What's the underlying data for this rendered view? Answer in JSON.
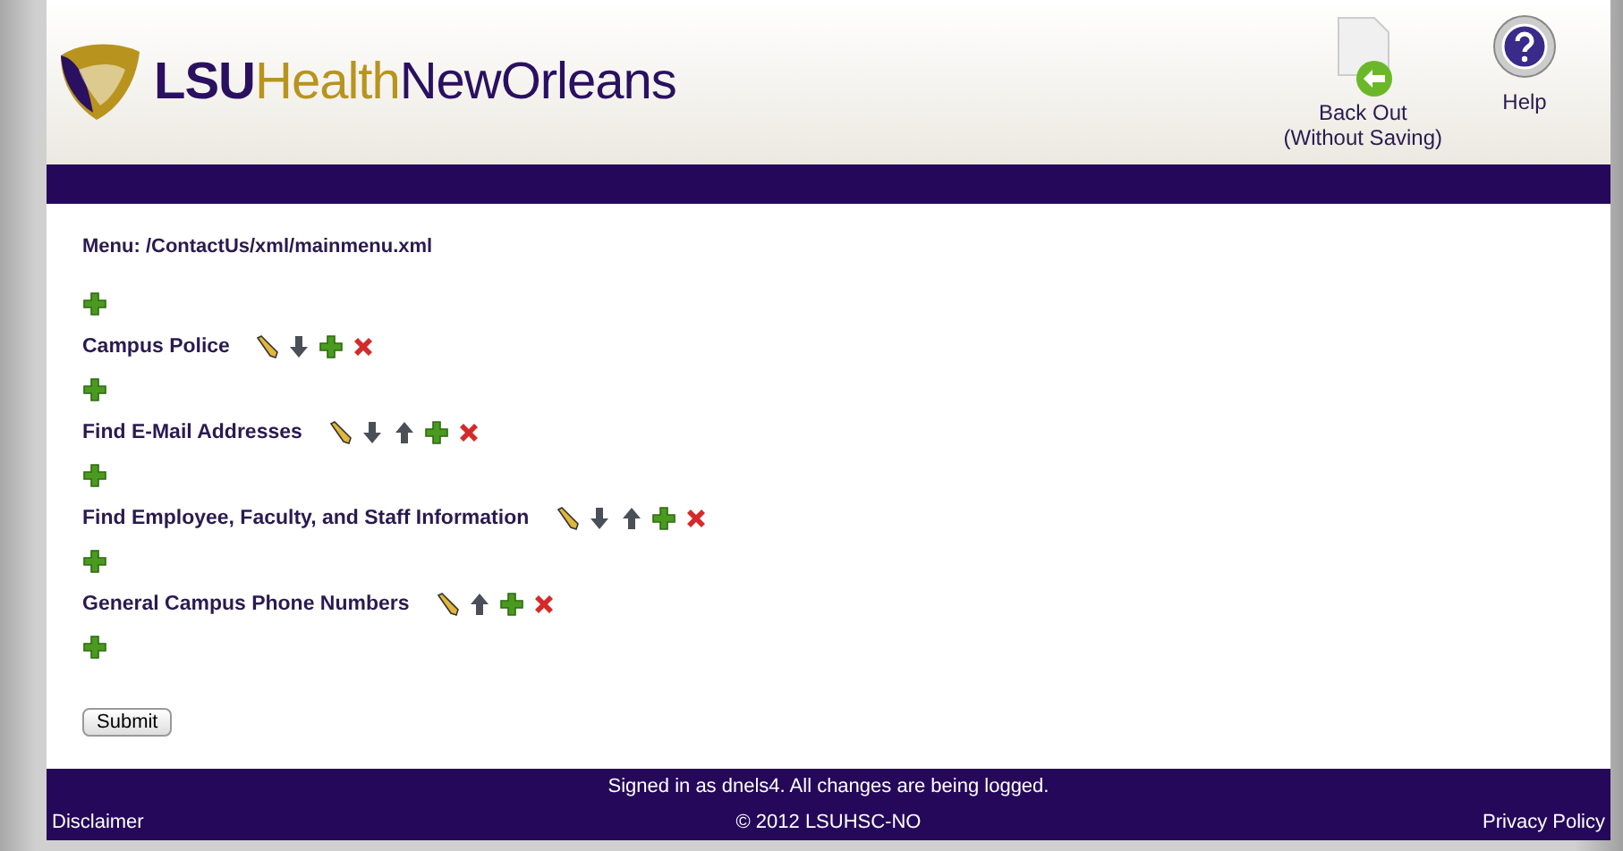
{
  "header": {
    "logo": [
      {
        "text": "LSU",
        "color": "#2a1060"
      },
      {
        "text": "Health",
        "color": "#b8941f"
      },
      {
        "text": "NewOrleans",
        "color": "#2a1060"
      }
    ],
    "actions": [
      {
        "kind": "back",
        "label": "Back Out",
        "sublabel": "(Without Saving)"
      },
      {
        "kind": "help",
        "label": "Help"
      }
    ]
  },
  "menu": {
    "title": "Menu: /ContactUs/xml/mainmenu.xml",
    "items": [
      {
        "label": "Campus Police",
        "actions": [
          {
            "kind": "edit"
          },
          {
            "kind": "down"
          },
          {
            "kind": "add"
          },
          {
            "kind": "delete"
          }
        ]
      },
      {
        "label": "Find E-Mail Addresses",
        "actions": [
          {
            "kind": "edit"
          },
          {
            "kind": "down"
          },
          {
            "kind": "up"
          },
          {
            "kind": "add"
          },
          {
            "kind": "delete"
          }
        ]
      },
      {
        "label": "Find Employee, Faculty, and Staff Information",
        "actions": [
          {
            "kind": "edit"
          },
          {
            "kind": "down"
          },
          {
            "kind": "up"
          },
          {
            "kind": "add"
          },
          {
            "kind": "delete"
          }
        ]
      },
      {
        "label": "General Campus Phone Numbers",
        "actions": [
          {
            "kind": "edit"
          },
          {
            "kind": "up"
          },
          {
            "kind": "add"
          },
          {
            "kind": "delete"
          }
        ]
      }
    ]
  },
  "submit": "Submit",
  "footer": {
    "notice": "Signed in as dnels4. All changes are being logged.",
    "left": "Disclaimer",
    "center": "© 2012 LSUHSC-NO",
    "right": "Privacy Policy"
  }
}
